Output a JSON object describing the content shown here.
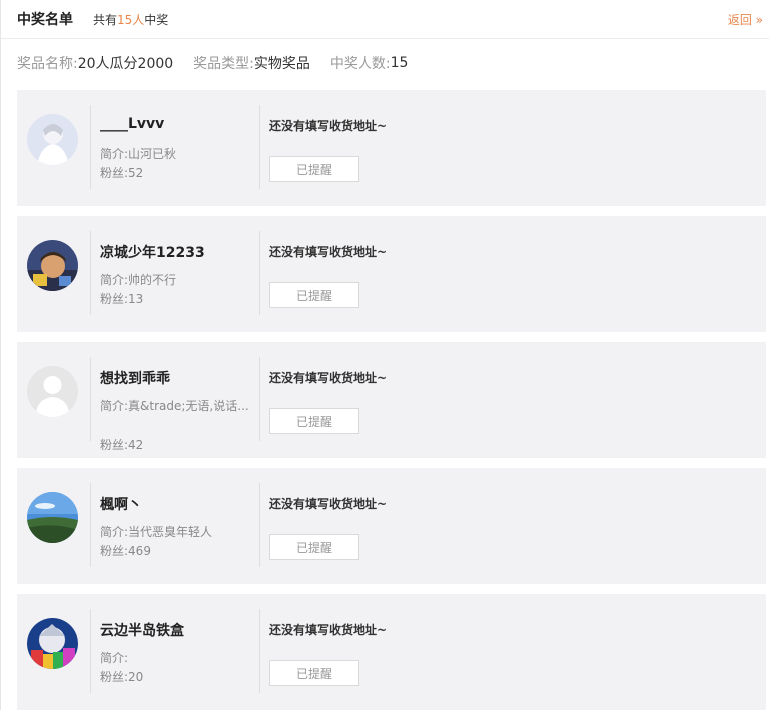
{
  "header": {
    "title": "中奖名单",
    "total_prefix": "共有",
    "total_count": "15人",
    "total_suffix": "中奖",
    "back_label": "返回 »"
  },
  "prize": {
    "name_label": "奖品名称:",
    "name_value": "20人瓜分2000",
    "type_label": "奖品类型:",
    "type_value": "实物奖品",
    "count_label": "中奖人数:",
    "count_value": "15"
  },
  "winners": [
    {
      "name": "____Lvvv",
      "intro": "简介:山河已秋",
      "fans": "粉丝:52",
      "address": "还没有填写收货地址~",
      "remind": "已提醒",
      "avatar": "avatar-anime"
    },
    {
      "name": "凉城少年12233",
      "intro": "简介:帅的不行",
      "fans": "粉丝:13",
      "address": "还没有填写收货地址~",
      "remind": "已提醒",
      "avatar": "avatar-kid"
    },
    {
      "name": "想找到乖乖",
      "intro": "简介:真&trade;无语,说话...",
      "fans": "粉丝:42",
      "address": "还没有填写收货地址~",
      "remind": "已提醒",
      "avatar": "avatar-default"
    },
    {
      "name": "楓啊丶",
      "intro": "简介:当代恶臭年轻人",
      "fans": "粉丝:469",
      "address": "还没有填写收货地址~",
      "remind": "已提醒",
      "avatar": "avatar-landscape"
    },
    {
      "name": "云边半岛铁盒",
      "intro": "简介:",
      "fans": "粉丝:20",
      "address": "还没有填写收货地址~",
      "remind": "已提醒",
      "avatar": "avatar-colorful"
    }
  ],
  "colors": {
    "accent": "#e9864b",
    "card_bg": "#f2f2f5"
  }
}
